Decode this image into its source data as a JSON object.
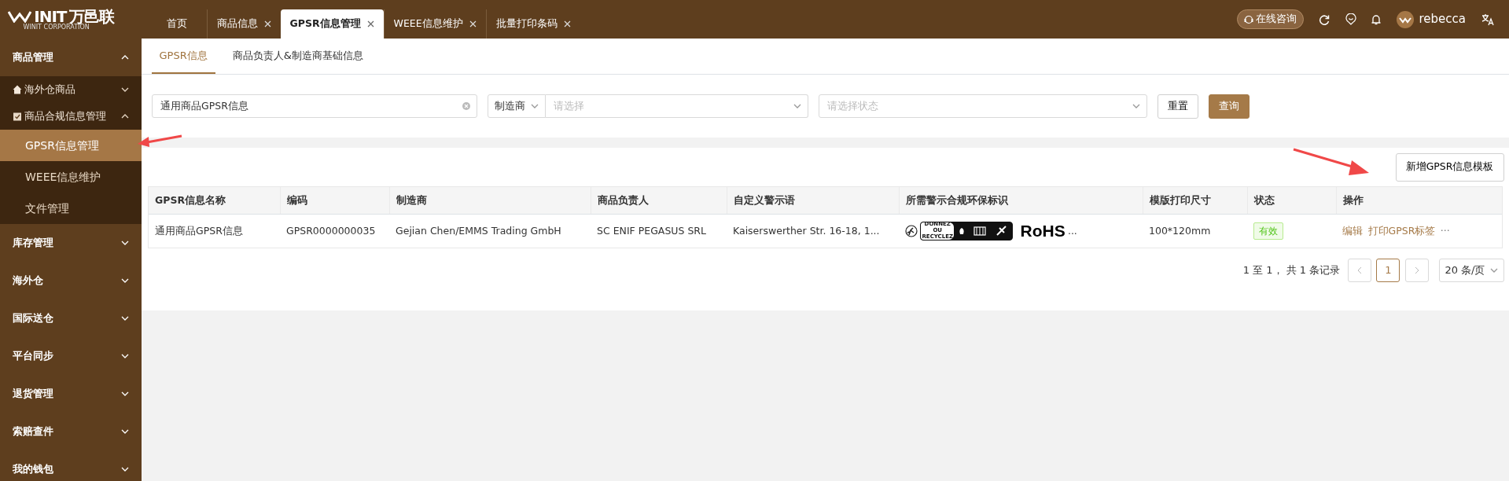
{
  "header": {
    "logo_word": "INIT",
    "logo_cn": "万邑联",
    "logo_sub": "WINIT CORPORATION",
    "consult_button": "在线咨询",
    "user": "rebecca"
  },
  "tabs": [
    {
      "label": "首页",
      "selected": false,
      "closable": false
    },
    {
      "label": "商品信息",
      "selected": false,
      "closable": true
    },
    {
      "label": "GPSR信息管理",
      "selected": true,
      "closable": true
    },
    {
      "label": "WEEE信息维护",
      "selected": false,
      "closable": true
    },
    {
      "label": "批量打印条码",
      "selected": false,
      "closable": true
    }
  ],
  "sidebar": {
    "items": [
      {
        "label": "商品管理",
        "expanded": true,
        "children": [
          {
            "label": "海外仓商品",
            "kind": "home",
            "expanded": false
          },
          {
            "label": "商品合规信息管理",
            "kind": "clipboard",
            "expanded": true,
            "children": [
              {
                "label": "GPSR信息管理",
                "selected": true
              },
              {
                "label": "WEEE信息维护",
                "selected": false
              },
              {
                "label": "文件管理",
                "selected": false
              }
            ]
          }
        ]
      },
      {
        "label": "库存管理",
        "expanded": false
      },
      {
        "label": "海外仓",
        "expanded": false
      },
      {
        "label": "国际送仓",
        "expanded": false
      },
      {
        "label": "平台同步",
        "expanded": false
      },
      {
        "label": "退货管理",
        "expanded": false
      },
      {
        "label": "索赔查件",
        "expanded": false
      },
      {
        "label": "我的钱包",
        "expanded": false
      }
    ]
  },
  "subtabs": [
    {
      "label": "GPSR信息",
      "selected": true
    },
    {
      "label": "商品负责人&制造商基础信息",
      "selected": false
    }
  ],
  "filters": {
    "name_value": "通用商品GPSR信息",
    "field_type": "制造商",
    "manufacturer_placeholder": "请选择",
    "status_placeholder": "请选择状态",
    "reset_button": "重置",
    "search_button": "查询"
  },
  "add_button": "新增GPSR信息模板",
  "table": {
    "columns": [
      "GPSR信息名称",
      "编码",
      "制造商",
      "商品负责人",
      "自定义警示语",
      "所需警示合规环保标识",
      "模版打印尺寸",
      "状态",
      "操作"
    ],
    "rows": [
      {
        "name": "通用商品GPSR信息",
        "code": "GPSR0000000035",
        "manufacturer": "Gejian Chen/EMMS Trading GmbH",
        "owner": "SC ENIF PEGASUS SRL",
        "warning": "Kaiserswerther Str. 16-18, 1...",
        "label_text": "DONNEZ OU RECYCLEZ",
        "rohs": "RoHS",
        "marks_more": "...",
        "size": "100*120mm",
        "status": "有效",
        "actions": [
          "编辑",
          "打印GPSR标签"
        ],
        "more": "···"
      }
    ]
  },
  "pagination": {
    "summary": "1 至 1， 共 1 条记录",
    "pages": [
      {
        "label": "1",
        "selected": true
      }
    ],
    "page_size": "20 条/页"
  }
}
